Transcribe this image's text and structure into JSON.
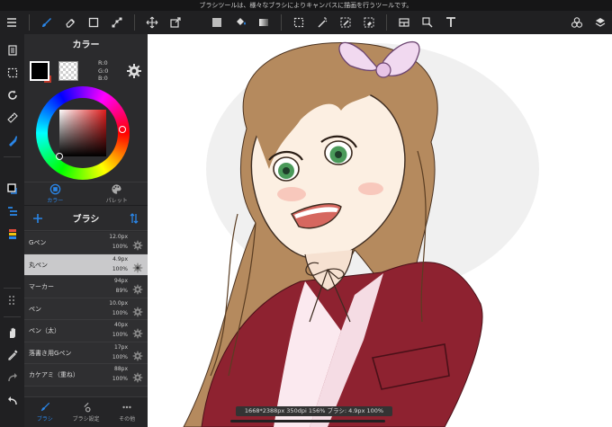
{
  "status_bar": {
    "message": "ブラシツールは、様々なブラシによりキャンバスに描画を行うツールです。"
  },
  "toolbar": {
    "left_icons": [
      "menu-icon",
      "brush-tool-icon",
      "eraser-tool-icon",
      "square-tool-icon",
      "transform-nodes-icon",
      "move-icon",
      "export-icon"
    ],
    "center_icons": [
      "fill-color-icon",
      "bucket-icon",
      "gradient-icon",
      "selection-rect-icon",
      "magic-wand-icon",
      "select-pen-icon",
      "select-eraser-icon",
      "layout-icon",
      "text-transform-icon",
      "text-icon"
    ],
    "right_icons": [
      "materials-icon",
      "layers-icon"
    ]
  },
  "rail": {
    "icons": [
      "pages-icon",
      "selection-icon",
      "rotate-icon",
      "ruler-icon",
      "fill-drop-icon",
      "color-swatch-icon",
      "brush-list-icon",
      "layer-colors-icon",
      "grid-icon",
      "hand-icon",
      "eyedropper-icon",
      "redo-icon",
      "undo-icon"
    ]
  },
  "color_panel": {
    "title": "カラー",
    "r_label": "R:0",
    "g_label": "G:0",
    "b_label": "B:0",
    "main_color": "#000000",
    "tabs": [
      {
        "label": "カラー",
        "icon": "color-circle-icon",
        "active": true
      },
      {
        "label": "パレット",
        "icon": "palette-icon",
        "active": false
      }
    ]
  },
  "brush_panel": {
    "title": "ブラシ",
    "add_icon": "plus-icon",
    "sort_icon": "sort-arrows-icon",
    "brushes": [
      {
        "name": "Gペン",
        "size": "12.0px",
        "opacity": "100%",
        "selected": false
      },
      {
        "name": "丸ペン",
        "size": "4.9px",
        "opacity": "100%",
        "selected": true
      },
      {
        "name": "マーカー",
        "size": "94px",
        "opacity": "89%",
        "selected": false
      },
      {
        "name": "ペン",
        "size": "10.0px",
        "opacity": "100%",
        "selected": false
      },
      {
        "name": "ペン（太）",
        "size": "40px",
        "opacity": "100%",
        "selected": false
      },
      {
        "name": "落書き用Gペン",
        "size": "17px",
        "opacity": "100%",
        "selected": false
      },
      {
        "name": "カケアミ（重ね）",
        "size": "88px",
        "opacity": "100%",
        "selected": false
      }
    ],
    "bottom_tabs": [
      {
        "label": "ブラシ",
        "icon": "brush-icon",
        "active": true
      },
      {
        "label": "ブラシ設定",
        "icon": "brush-settings-icon",
        "active": false
      },
      {
        "label": "その他",
        "icon": "more-icon",
        "active": false
      }
    ]
  },
  "canvas": {
    "info": "1668*2388px 350dpi 156% ブラシ: 4.9px 100%",
    "hair_color": "#b58a5e",
    "jacket_color": "#8e2230",
    "ribbon_color": "#f1d9f0",
    "eye_color": "#4a9a5a"
  }
}
